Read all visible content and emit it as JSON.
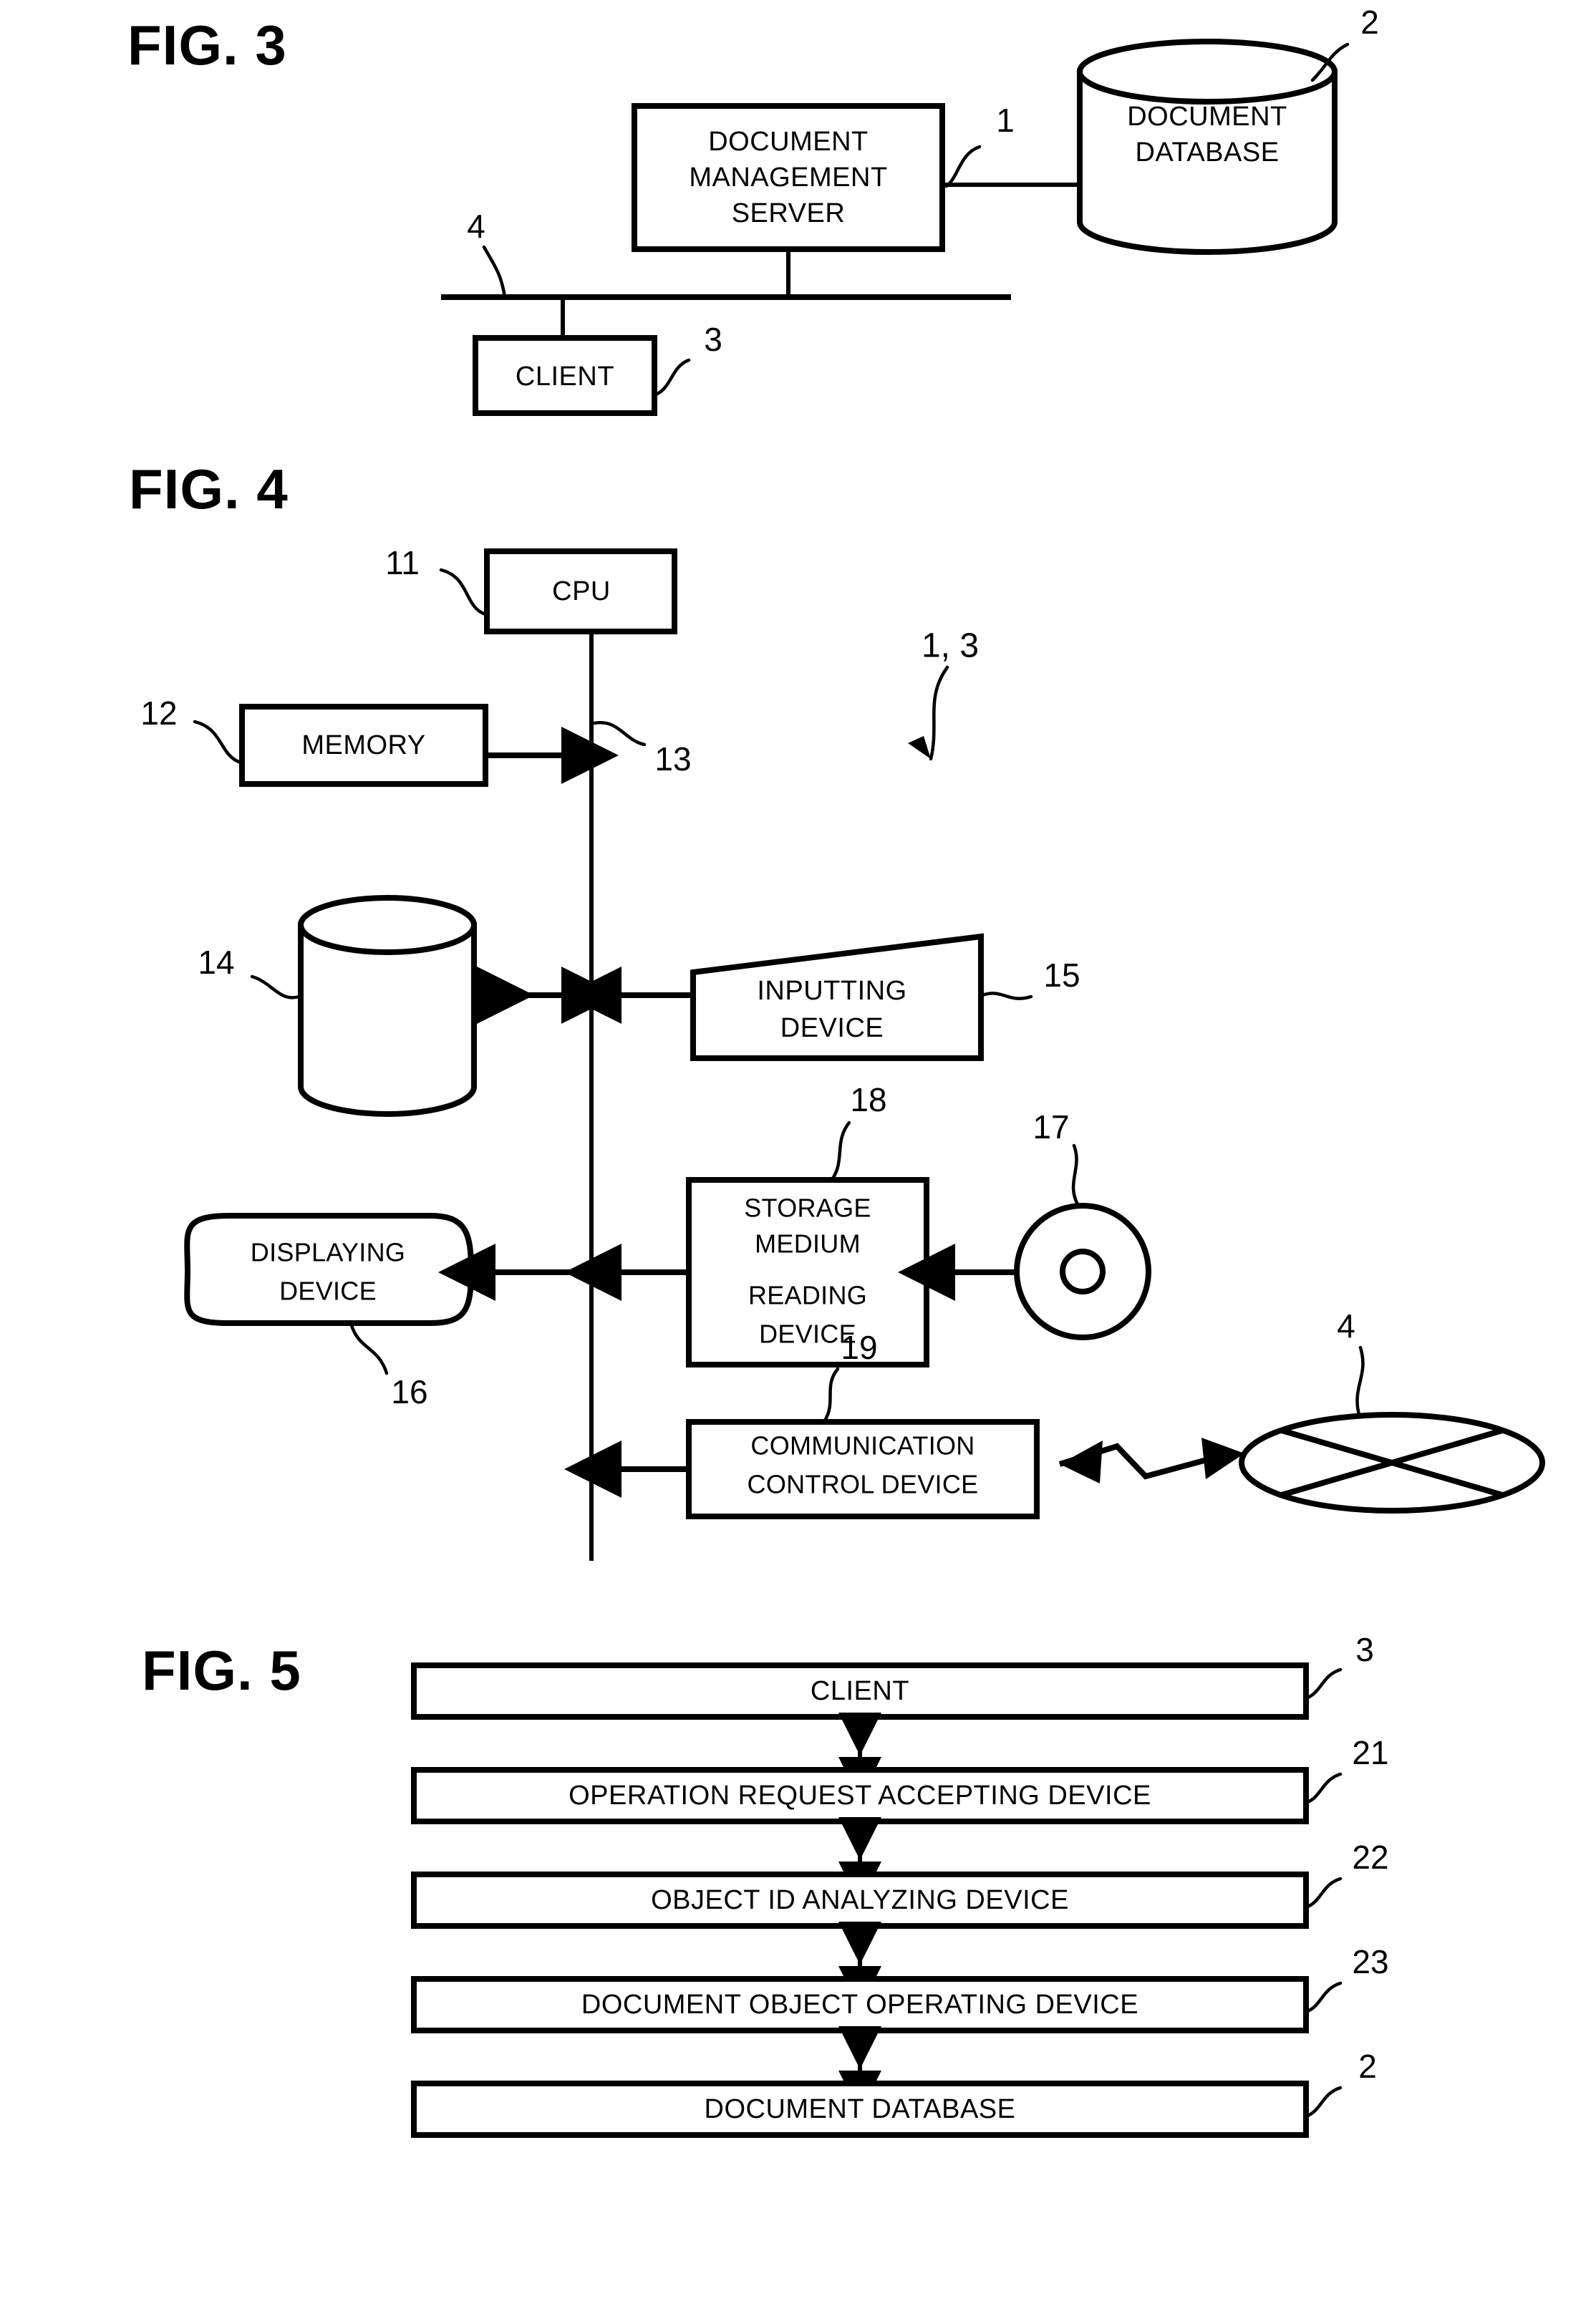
{
  "figures": [
    {
      "id": "fig3",
      "title": "FIG. 3",
      "nodes": [
        {
          "key": "server",
          "label_lines": [
            "DOCUMENT",
            "MANAGEMENT",
            "SERVER"
          ],
          "ref": "1"
        },
        {
          "key": "database",
          "label_lines": [
            "DOCUMENT",
            "DATABASE"
          ],
          "ref": "2"
        },
        {
          "key": "client",
          "label_lines": [
            "CLIENT"
          ],
          "ref": "3"
        },
        {
          "key": "network",
          "label_lines": [],
          "ref": "4"
        }
      ]
    },
    {
      "id": "fig4",
      "title": "FIG. 4",
      "group_ref": "1, 3",
      "nodes": [
        {
          "key": "cpu",
          "label_lines": [
            "CPU"
          ],
          "ref": "11"
        },
        {
          "key": "memory",
          "label_lines": [
            "MEMORY"
          ],
          "ref": "12"
        },
        {
          "key": "bus",
          "label_lines": [],
          "ref": "13"
        },
        {
          "key": "storage",
          "label_lines": [],
          "ref": "14"
        },
        {
          "key": "inputting",
          "label_lines": [
            "INPUTTING",
            "DEVICE"
          ],
          "ref": "15"
        },
        {
          "key": "displaying",
          "label_lines": [
            "DISPLAYING",
            "DEVICE"
          ],
          "ref": "16"
        },
        {
          "key": "medium",
          "label_lines": [],
          "ref": "17"
        },
        {
          "key": "medium_reader",
          "label_lines": [
            "STORAGE",
            "MEDIUM",
            "READING",
            "DEVICE"
          ],
          "ref": "18"
        },
        {
          "key": "comm",
          "label_lines": [
            "COMMUNICATION",
            "CONTROL DEVICE"
          ],
          "ref": "19"
        },
        {
          "key": "network",
          "label_lines": [],
          "ref": "4"
        }
      ]
    },
    {
      "id": "fig5",
      "title": "FIG. 5",
      "nodes": [
        {
          "key": "client",
          "label_lines": [
            "CLIENT"
          ],
          "ref": "3"
        },
        {
          "key": "opreq",
          "label_lines": [
            "OPERATION REQUEST ACCEPTING DEVICE"
          ],
          "ref": "21"
        },
        {
          "key": "objid",
          "label_lines": [
            "OBJECT ID ANALYZING DEVICE"
          ],
          "ref": "22"
        },
        {
          "key": "docobj",
          "label_lines": [
            "DOCUMENT OBJECT OPERATING DEVICE"
          ],
          "ref": "23"
        },
        {
          "key": "docdb",
          "label_lines": [
            "DOCUMENT DATABASE"
          ],
          "ref": "2"
        }
      ]
    }
  ],
  "fig3": {
    "title": "FIG. 3",
    "server_l1": "DOCUMENT",
    "server_l2": "MANAGEMENT",
    "server_l3": "SERVER",
    "server_ref": "1",
    "db_l1": "DOCUMENT",
    "db_l2": "DATABASE",
    "db_ref": "2",
    "client_label": "CLIENT",
    "client_ref": "3",
    "network_ref": "4"
  },
  "fig4": {
    "title": "FIG. 4",
    "group_ref": "1, 3",
    "cpu_label": "CPU",
    "cpu_ref": "11",
    "memory_label": "MEMORY",
    "memory_ref": "12",
    "bus_ref": "13",
    "storage_ref": "14",
    "input_l1": "INPUTTING",
    "input_l2": "DEVICE",
    "input_ref": "15",
    "display_l1": "DISPLAYING",
    "display_l2": "DEVICE",
    "display_ref": "16",
    "medium_ref": "17",
    "reader_l1": "STORAGE",
    "reader_l2": "MEDIUM",
    "reader_l3": "READING",
    "reader_l4": "DEVICE",
    "reader_ref": "18",
    "comm_l1": "COMMUNICATION",
    "comm_l2": "CONTROL DEVICE",
    "comm_ref": "19",
    "network_ref": "4"
  },
  "fig5": {
    "title": "FIG. 5",
    "bar1_label": "CLIENT",
    "bar1_ref": "3",
    "bar2_label": "OPERATION REQUEST ACCEPTING DEVICE",
    "bar2_ref": "21",
    "bar3_label": "OBJECT ID ANALYZING DEVICE",
    "bar3_ref": "22",
    "bar4_label": "DOCUMENT OBJECT OPERATING DEVICE",
    "bar4_ref": "23",
    "bar5_label": "DOCUMENT DATABASE",
    "bar5_ref": "2"
  },
  "colors": {
    "ink": "#000000",
    "paper": "#ffffff"
  }
}
